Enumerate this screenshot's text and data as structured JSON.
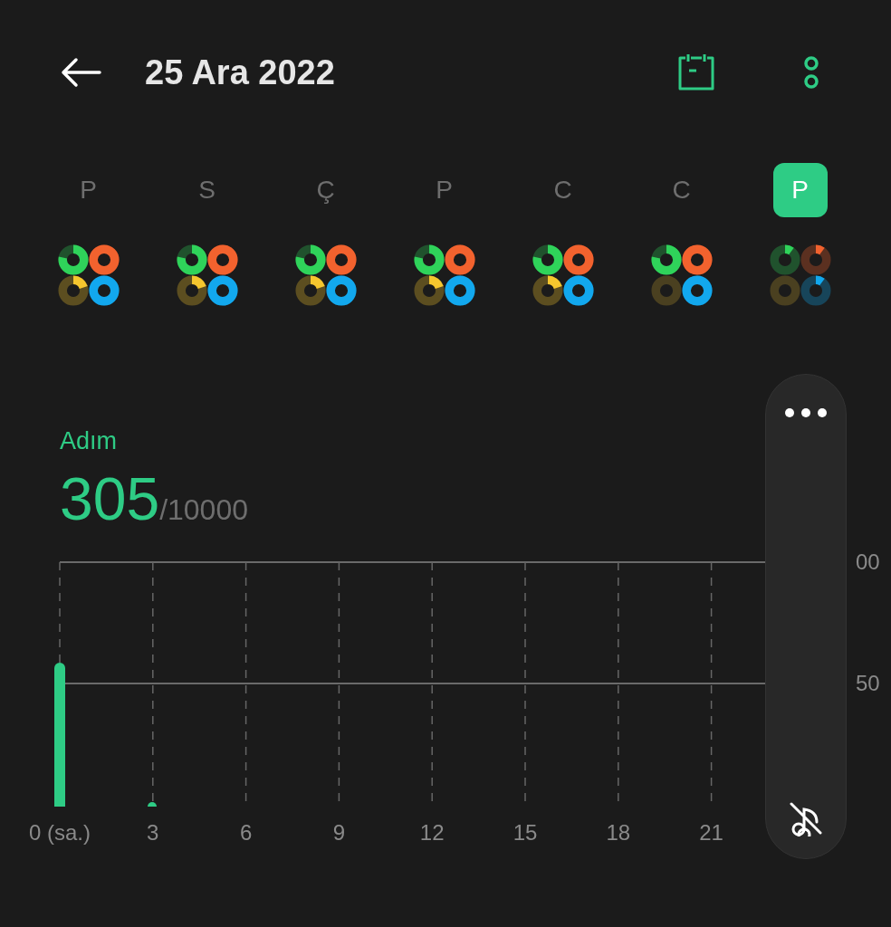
{
  "header": {
    "title": "25 Ara 2022"
  },
  "days": [
    {
      "letter": "P",
      "selected": false,
      "rings": [
        {
          "color": "#2fd35a",
          "kind": "most"
        },
        {
          "color": "#f2622e",
          "kind": "full"
        },
        {
          "color": "#f5c62e",
          "kind": "little"
        },
        {
          "color": "#12a8ee",
          "kind": "full"
        }
      ]
    },
    {
      "letter": "S",
      "selected": false,
      "rings": [
        {
          "color": "#2fd35a",
          "kind": "most"
        },
        {
          "color": "#f2622e",
          "kind": "full"
        },
        {
          "color": "#f5c62e",
          "kind": "little"
        },
        {
          "color": "#12a8ee",
          "kind": "full"
        }
      ]
    },
    {
      "letter": "Ç",
      "selected": false,
      "rings": [
        {
          "color": "#2fd35a",
          "kind": "most"
        },
        {
          "color": "#f2622e",
          "kind": "full"
        },
        {
          "color": "#f5c62e",
          "kind": "little"
        },
        {
          "color": "#12a8ee",
          "kind": "full"
        }
      ]
    },
    {
      "letter": "P",
      "selected": false,
      "rings": [
        {
          "color": "#2fd35a",
          "kind": "most"
        },
        {
          "color": "#f2622e",
          "kind": "full"
        },
        {
          "color": "#f5c62e",
          "kind": "little"
        },
        {
          "color": "#12a8ee",
          "kind": "full"
        }
      ]
    },
    {
      "letter": "C",
      "selected": false,
      "rings": [
        {
          "color": "#2fd35a",
          "kind": "most"
        },
        {
          "color": "#f2622e",
          "kind": "full"
        },
        {
          "color": "#f5c62e",
          "kind": "little"
        },
        {
          "color": "#12a8ee",
          "kind": "full"
        }
      ]
    },
    {
      "letter": "C",
      "selected": false,
      "rings": [
        {
          "color": "#2fd35a",
          "kind": "most"
        },
        {
          "color": "#f2622e",
          "kind": "full"
        },
        {
          "color": "#4a4020",
          "kind": "none"
        },
        {
          "color": "#12a8ee",
          "kind": "full"
        }
      ]
    },
    {
      "letter": "P",
      "selected": true,
      "rings": [
        {
          "color": "#2fd35a",
          "kind": "tiny"
        },
        {
          "color": "#f2622e",
          "kind": "tiny"
        },
        {
          "color": "#4a4020",
          "kind": "none"
        },
        {
          "color": "#12a8ee",
          "kind": "tiny"
        }
      ]
    }
  ],
  "steps": {
    "label": "Adım",
    "value": "305",
    "goal": "/10000"
  },
  "chart": {
    "x_labels": [
      "0 (sa.)",
      "3",
      "6",
      "9",
      "12",
      "15",
      "18",
      "21"
    ],
    "y_labels": [
      "00",
      "50"
    ]
  }
}
